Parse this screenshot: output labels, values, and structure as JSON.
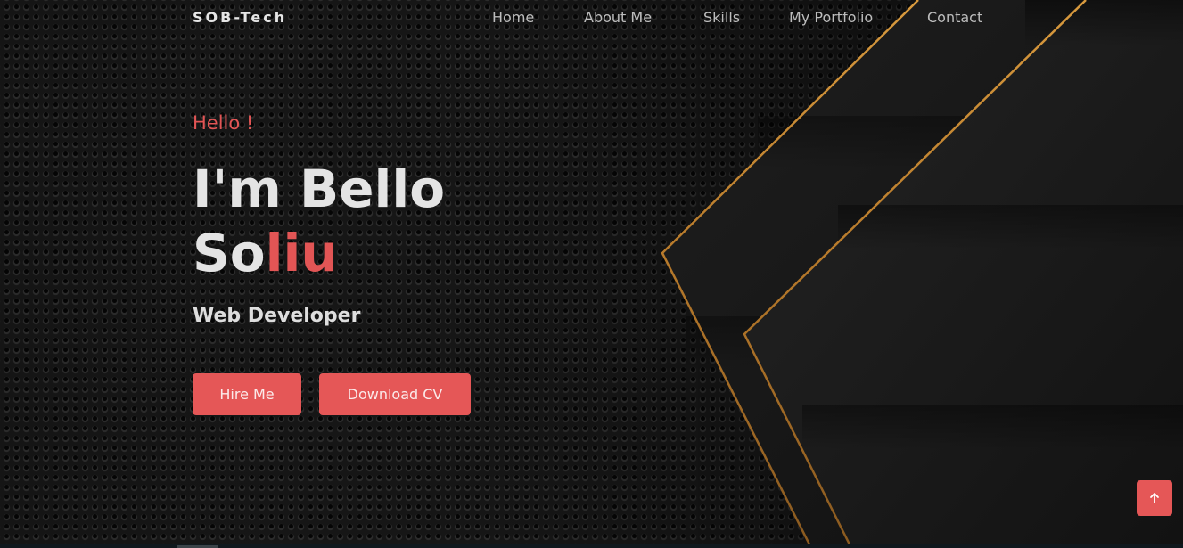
{
  "header": {
    "logo": "SOB-Tech",
    "nav": [
      {
        "label": "Home"
      },
      {
        "label": "About Me"
      },
      {
        "label": "Skills"
      },
      {
        "label": "My Portfolio"
      },
      {
        "label": "Contact"
      }
    ]
  },
  "hero": {
    "greeting": "Hello !",
    "headline_line1": "I'm Bello",
    "headline_line2_plain": "So",
    "headline_line2_accent": "liu",
    "role": "Web Developer",
    "hire_label": "Hire Me",
    "download_label": "Download CV"
  },
  "scroll_top": {
    "icon": "arrow-up-icon"
  },
  "colors": {
    "accent": "#e55757",
    "background": "#161616",
    "gold": "#c9892f",
    "text": "#e4e4e4"
  }
}
